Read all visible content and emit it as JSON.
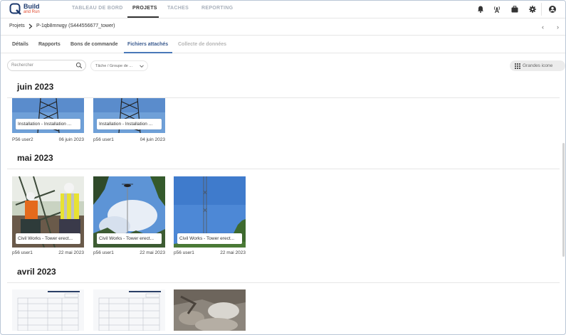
{
  "app": {
    "logo_line1": "Build",
    "logo_line2": "and Run"
  },
  "topnav": {
    "items": [
      {
        "label": "TABLEAU DE BORD",
        "active": false
      },
      {
        "label": "PROJETS",
        "active": true
      },
      {
        "label": "TACHES",
        "active": false
      },
      {
        "label": "REPORTING",
        "active": false
      }
    ],
    "icons": [
      "bell-icon",
      "antenna-icon",
      "briefcase-icon",
      "gear-icon",
      "account-icon"
    ]
  },
  "breadcrumb": {
    "root": "Projets",
    "current": "P-1qb8mrwgy (S444556677_tower)"
  },
  "tabs": [
    {
      "label": "Détails",
      "state": "normal"
    },
    {
      "label": "Rapports",
      "state": "normal"
    },
    {
      "label": "Bons de commande",
      "state": "normal"
    },
    {
      "label": "Fichiers attachés",
      "state": "active"
    },
    {
      "label": "Collecte de données",
      "state": "disabled"
    }
  ],
  "filters": {
    "search_placeholder": "Rechercher",
    "task_filter": "Tâche / Groupe de ...",
    "view_toggle": "Grandes icone"
  },
  "sections": [
    {
      "title": "juin 2023",
      "items": [
        {
          "caption": "Installation - Installation ...",
          "user": "P56 user2",
          "date": "06 juin 2023",
          "image": "tower-sky"
        },
        {
          "caption": "Installation - Installation ...",
          "user": "p56 user1",
          "date": "04 juin 2023",
          "image": "tower-sky"
        }
      ]
    },
    {
      "title": "mai 2023",
      "items": [
        {
          "caption": "Civil Works - Tower erect...",
          "user": "p56 user1",
          "date": "22 mai 2023",
          "image": "workers"
        },
        {
          "caption": "Civil Works - Tower erect...",
          "user": "p56 user1",
          "date": "22 mai 2023",
          "image": "helicopter-sky"
        },
        {
          "caption": "Civil Works - Tower erect...",
          "user": "p56 user1",
          "date": "22 mai 2023",
          "image": "mast-blue-sky"
        }
      ]
    },
    {
      "title": "avril 2023",
      "items": [
        {
          "caption": "",
          "user": "",
          "date": "",
          "image": "document"
        },
        {
          "caption": "",
          "user": "",
          "date": "",
          "image": "document"
        },
        {
          "caption": "",
          "user": "",
          "date": "",
          "image": "rocks"
        }
      ]
    }
  ],
  "colors": {
    "accent": "#4a78b8",
    "sky": "#4d88d6"
  }
}
